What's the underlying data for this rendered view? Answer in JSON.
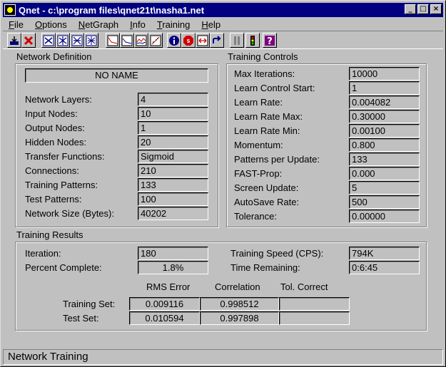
{
  "window": {
    "title": "Qnet - c:\\program files\\qnet21t\\nasha1.net",
    "minimize": "_",
    "maximize": "□",
    "close": "×"
  },
  "menu": [
    {
      "label": "File",
      "key": "F",
      "rest": "ile"
    },
    {
      "label": "Options",
      "key": "O",
      "rest": "ptions"
    },
    {
      "label": "NetGraph",
      "key": "N",
      "rest": "etGraph"
    },
    {
      "label": "Info",
      "key": "I",
      "rest": "nfo"
    },
    {
      "label": "Training",
      "key": "T",
      "rest": "raining"
    },
    {
      "label": "Help",
      "key": "H",
      "rest": "elp"
    }
  ],
  "network_definition": {
    "title": "Network Definition",
    "name": "NO NAME",
    "rows": [
      {
        "label": "Network Layers:",
        "value": "4"
      },
      {
        "label": "Input Nodes:",
        "value": "10"
      },
      {
        "label": "Output Nodes:",
        "value": "1"
      },
      {
        "label": "Hidden Nodes:",
        "value": "20"
      },
      {
        "label": "Transfer Functions:",
        "value": "Sigmoid"
      },
      {
        "label": "Connections:",
        "value": "210"
      },
      {
        "label": "Training Patterns:",
        "value": "133"
      },
      {
        "label": "Test Patterns:",
        "value": "100"
      },
      {
        "label": "Network Size (Bytes):",
        "value": "40202"
      }
    ]
  },
  "training_controls": {
    "title": "Training Controls",
    "rows": [
      {
        "label": "Max Iterations:",
        "value": "10000"
      },
      {
        "label": "Learn Control Start:",
        "value": "1"
      },
      {
        "label": "Learn Rate:",
        "value": "0.004082"
      },
      {
        "label": "Learn Rate Max:",
        "value": "0.30000"
      },
      {
        "label": "Learn Rate Min:",
        "value": "0.00100"
      },
      {
        "label": "Momentum:",
        "value": "0.800"
      },
      {
        "label": "Patterns per Update:",
        "value": "133"
      },
      {
        "label": "FAST-Prop:",
        "value": "0.000"
      },
      {
        "label": "Screen Update:",
        "value": "5"
      },
      {
        "label": "AutoSave Rate:",
        "value": "500"
      },
      {
        "label": "Tolerance:",
        "value": "0.00000"
      }
    ]
  },
  "training_results": {
    "title": "Training Results",
    "iteration_label": "Iteration:",
    "iteration": "180",
    "percent_label": "Percent Complete:",
    "percent": "1.8%",
    "speed_label": "Training Speed (CPS):",
    "speed": "794K",
    "remaining_label": "Time Remaining:",
    "remaining": "0:6:45",
    "headers": [
      "RMS Error",
      "Correlation",
      "Tol. Correct"
    ],
    "rows": [
      {
        "label": "Training Set:",
        "rms": "0.009116",
        "corr": "0.998512",
        "tol": ""
      },
      {
        "label": "Test Set:",
        "rms": "0.010594",
        "corr": "0.997898",
        "tol": ""
      }
    ]
  },
  "toolbar_icons": [
    "save-exit-icon",
    "close-x-icon",
    "network-icon-1",
    "network-icon-2",
    "network-icon-3",
    "network-icon-4",
    "error-graph-icon",
    "test-graph-icon",
    "line-graph-icon",
    "scatter-graph-icon",
    "info-icon",
    "stop-icon",
    "resize-icon",
    "return-icon",
    "pause-icon",
    "traffic-light-icon",
    "help-icon"
  ],
  "status": {
    "text": "Network Training"
  }
}
